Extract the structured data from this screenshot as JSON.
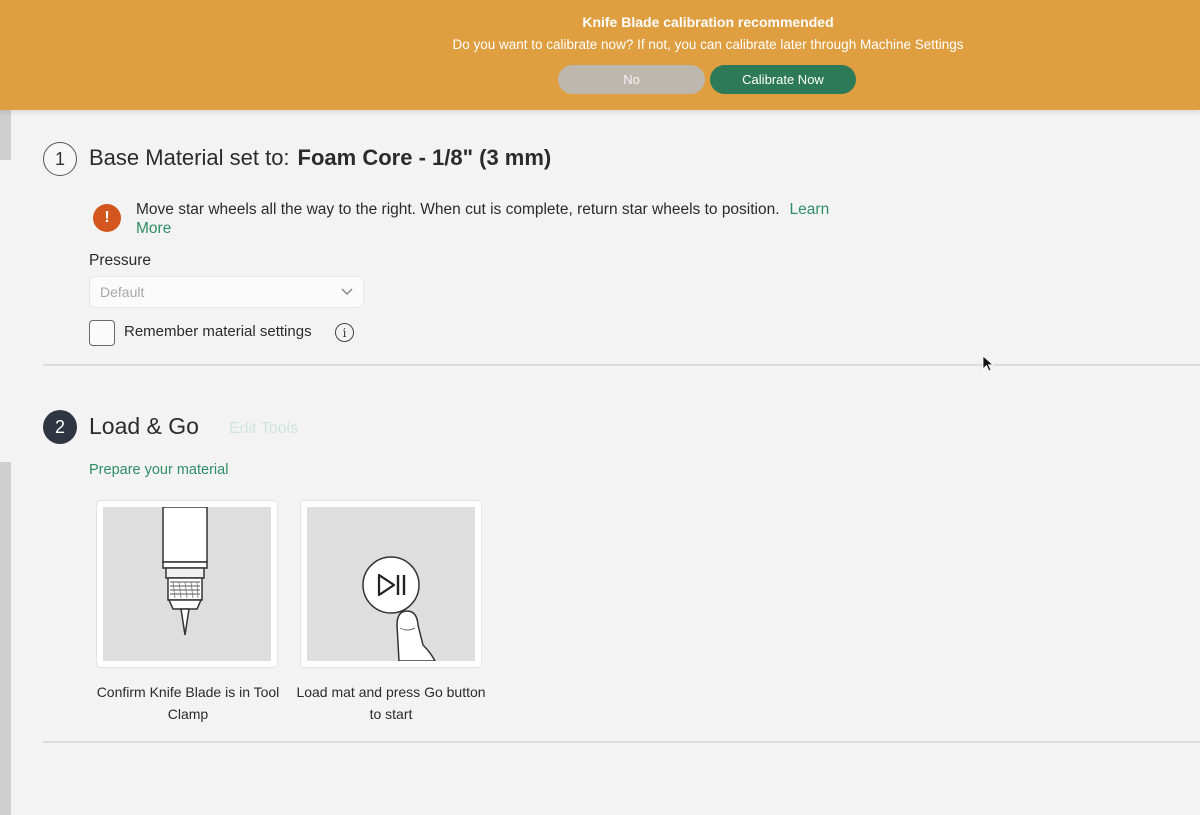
{
  "banner": {
    "title": "Knife Blade calibration recommended",
    "message": "Do you want to calibrate now? If not, you can calibrate later through Machine Settings",
    "no_label": "No",
    "calibrate_label": "Calibrate Now",
    "color": "#df9f41",
    "calibrate_color": "#2d7a58"
  },
  "step1": {
    "number": "1",
    "heading_prefix": "Base Material set to:",
    "material": "Foam Core - 1/8\" (3 mm)",
    "warning_text": "Move star wheels all the way to the right. When cut is complete, return star wheels to position.",
    "learn_more": "Learn More",
    "pressure_label": "Pressure",
    "pressure_value": "Default",
    "remember_label": "Remember material settings",
    "remember_checked": false
  },
  "step2": {
    "number": "2",
    "heading": "Load & Go",
    "edit_tools": "Edit Tools",
    "prepare_label": "Prepare your material",
    "cards": [
      {
        "caption": "Confirm Knife Blade is in Tool Clamp",
        "icon": "knife-blade-illustration"
      },
      {
        "caption": "Load mat and press Go button to start",
        "icon": "go-button-illustration"
      }
    ]
  },
  "icons": {
    "warning": "warning-icon",
    "info": "info-icon",
    "chevron": "chevron-down-icon"
  }
}
